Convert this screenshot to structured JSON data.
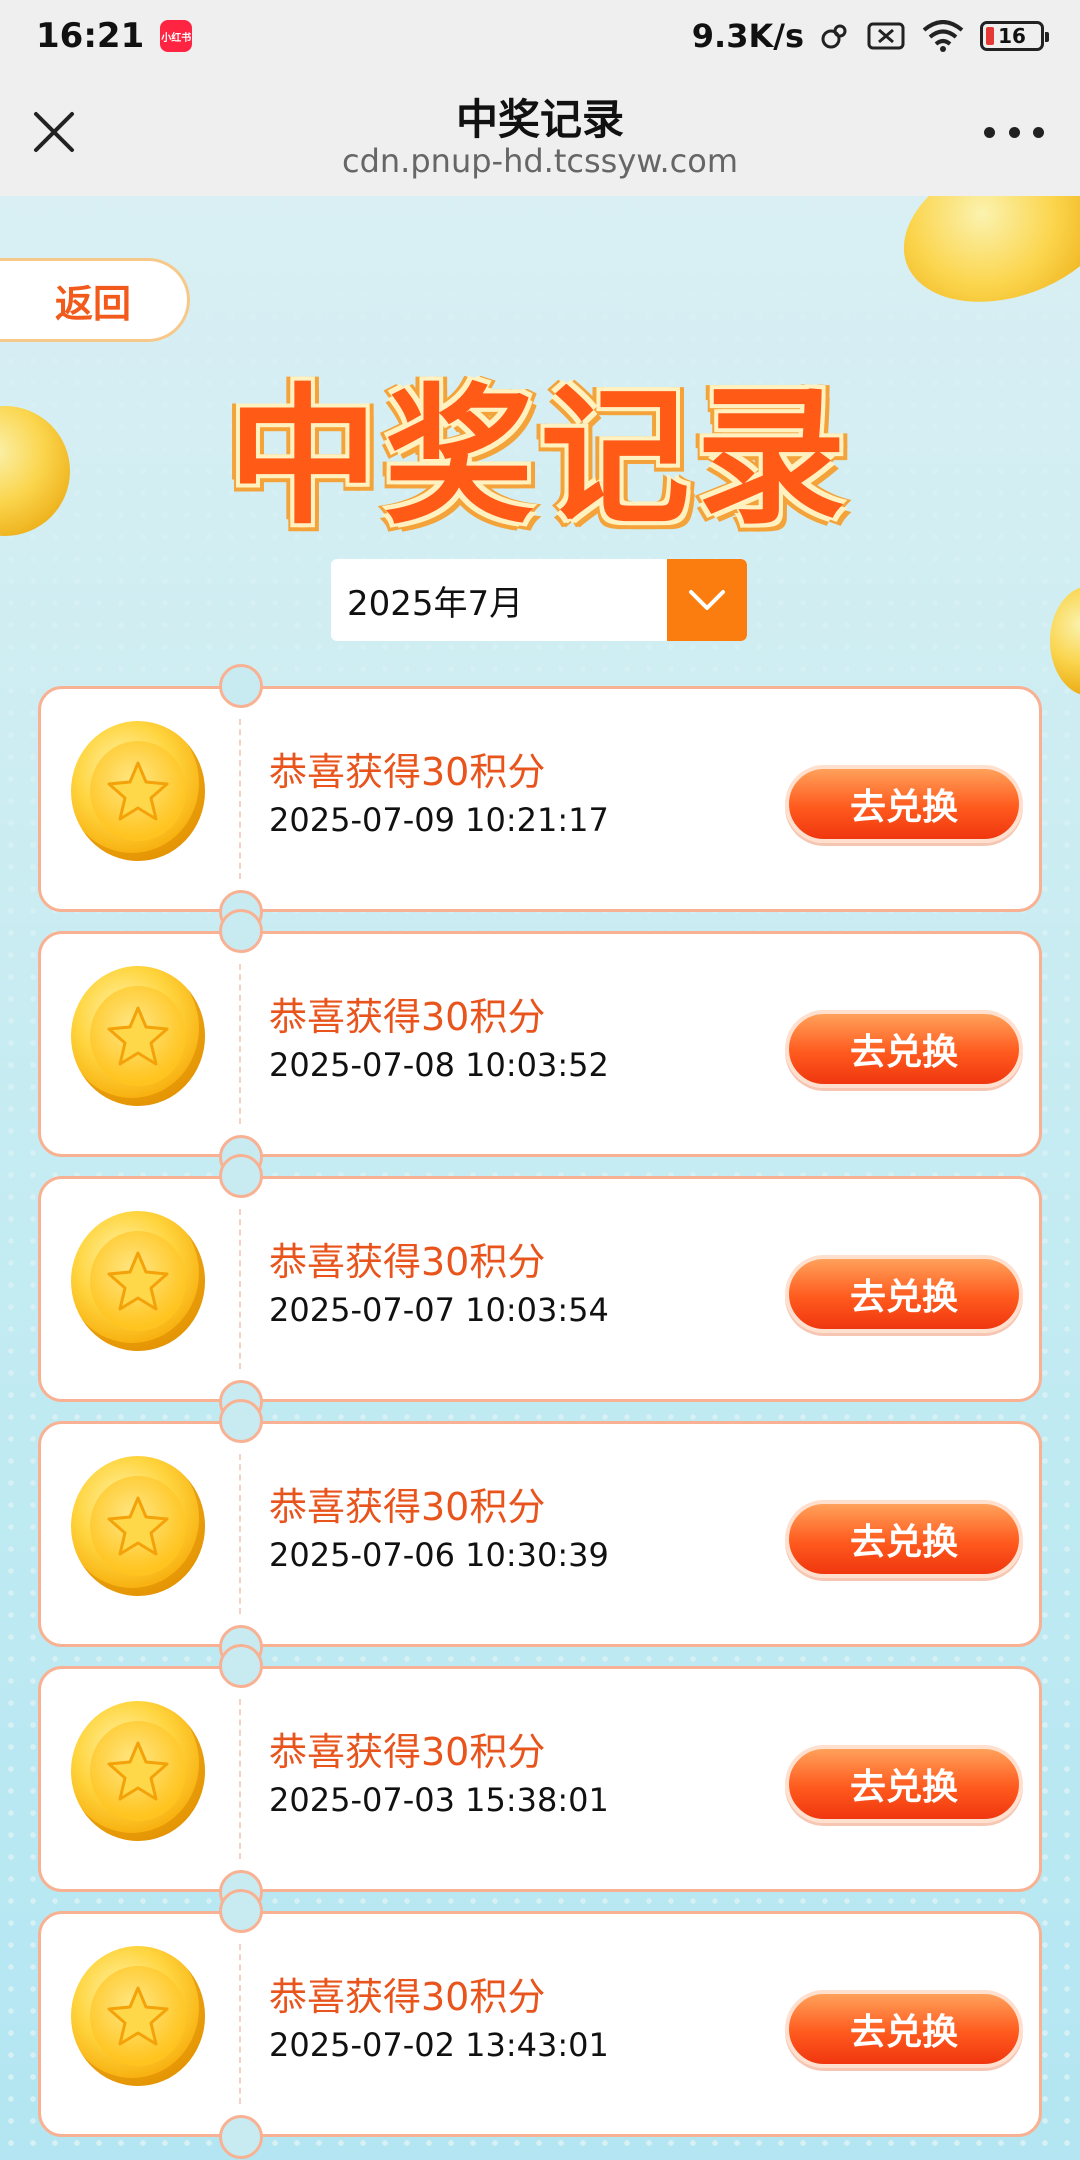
{
  "status_bar": {
    "time": "16:21",
    "app_badge": "小红书",
    "net_speed": "9.3K/s",
    "battery": "16"
  },
  "title_bar": {
    "title": "中奖记录",
    "url": "cdn.pnup-hd.tcssyw.com"
  },
  "page": {
    "back_label": "返回",
    "heading": "中奖记录",
    "date_selected": "2025年7月"
  },
  "records": [
    {
      "title": "恭喜获得30积分",
      "time": "2025-07-09 10:21:17",
      "button": "去兑换"
    },
    {
      "title": "恭喜获得30积分",
      "time": "2025-07-08 10:03:52",
      "button": "去兑换"
    },
    {
      "title": "恭喜获得30积分",
      "time": "2025-07-07 10:03:54",
      "button": "去兑换"
    },
    {
      "title": "恭喜获得30积分",
      "time": "2025-07-06 10:30:39",
      "button": "去兑换"
    },
    {
      "title": "恭喜获得30积分",
      "time": "2025-07-03 15:38:01",
      "button": "去兑换"
    },
    {
      "title": "恭喜获得30积分",
      "time": "2025-07-02 13:43:01",
      "button": "去兑换"
    }
  ],
  "colors": {
    "accent": "#ff5a16",
    "button": "#f0360f",
    "select_arrow": "#fb7c0f",
    "card_border": "#f8b192"
  }
}
